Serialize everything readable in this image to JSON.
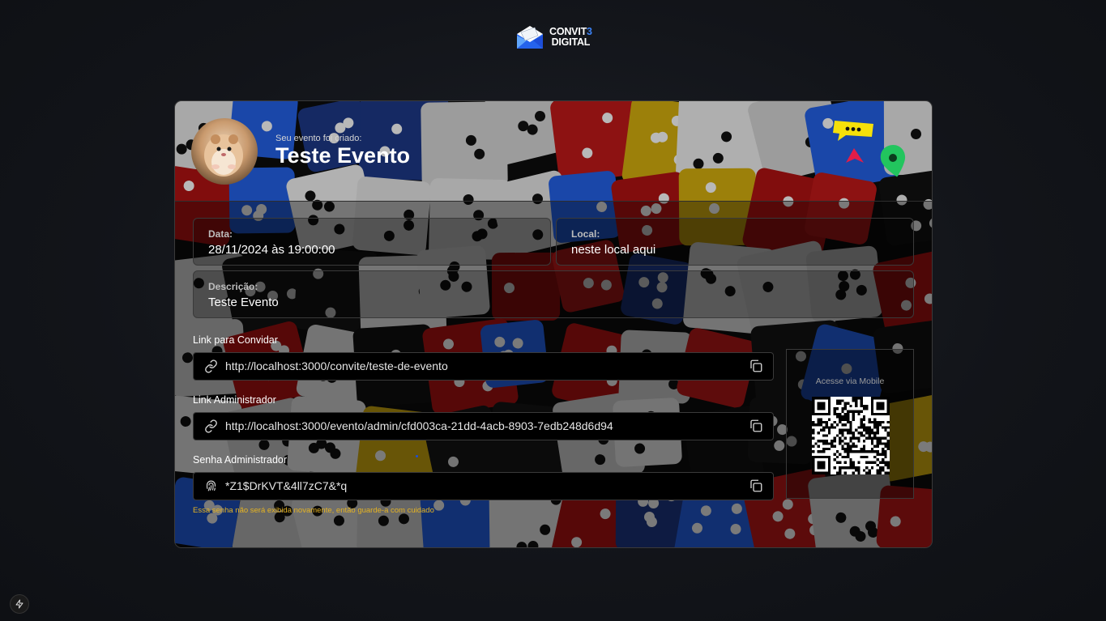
{
  "brand": {
    "line1_prefix": "CONVIT",
    "line1_accent": "3",
    "line2": "DIGITAL"
  },
  "header": {
    "subtitle": "Seu evento foi criado:",
    "title": "Teste Evento"
  },
  "details": {
    "date_label": "Data:",
    "date_value": "28/11/2024 às 19:00:00",
    "location_label": "Local:",
    "location_value": "neste local aqui",
    "description_label": "Descrição:",
    "description_value": "Teste Evento"
  },
  "links": {
    "invite_label": "Link para Convidar",
    "invite_url": "http://localhost:3000/convite/teste-de-evento",
    "admin_label": "Link Administrador",
    "admin_url": "http://localhost:3000/evento/admin/cfd003ca-21dd-4acb-8903-7edb248d6d94",
    "password_label": "Senha Administrador",
    "password_value": "*Z1$DrKVT&4ll7zC7&*q",
    "password_warning": "Essa senha não será exibida novamente, então guarde-a com cuidado"
  },
  "qr": {
    "caption": "Acesse via Mobile"
  },
  "icons": {
    "link": "link-icon",
    "copy": "copy-icon",
    "fingerprint": "fingerprint-icon",
    "chat": "chat-bubble-icon",
    "pin": "map-pin-icon",
    "cursor": "cursor-arrow-icon",
    "bolt": "lightning-icon"
  },
  "colors": {
    "background": "#121419",
    "accent_blue": "#3b82f6",
    "warning": "#e6b422",
    "chat_yellow": "#f5e00a",
    "pin_green": "#22c55e",
    "cursor_red": "#e11d48"
  }
}
